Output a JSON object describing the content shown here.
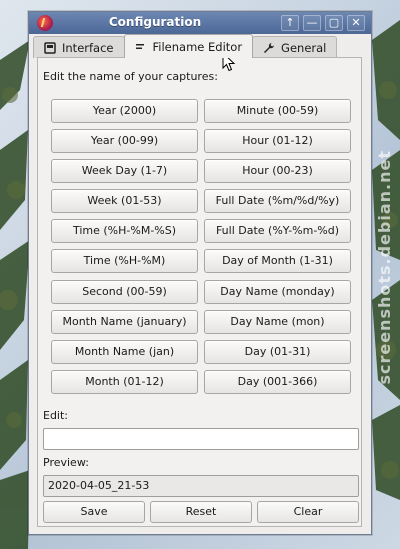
{
  "window": {
    "title": "Configuration",
    "controls": [
      "↑",
      "—",
      "▢",
      "✕"
    ]
  },
  "tabs": [
    {
      "label": "Interface",
      "icon": "interface-icon",
      "active": false
    },
    {
      "label": "Filename Editor",
      "icon": "text-lines-icon",
      "active": true
    },
    {
      "label": "General",
      "icon": "wrench-icon",
      "active": false
    }
  ],
  "editor": {
    "prompt": "Edit the name of your captures:",
    "buttons_left": [
      "Year (2000)",
      "Year (00-99)",
      "Week Day (1-7)",
      "Week (01-53)",
      "Time (%H-%M-%S)",
      "Time (%H-%M)",
      "Second (00-59)",
      "Month Name (january)",
      "Month Name (jan)",
      "Month (01-12)"
    ],
    "buttons_right": [
      "Minute (00-59)",
      "Hour (01-12)",
      "Hour (00-23)",
      "Full Date (%m/%d/%y)",
      "Full Date (%Y-%m-%d)",
      "Day of Month (1-31)",
      "Day Name (monday)",
      "Day Name (mon)",
      "Day (01-31)",
      "Day (001-366)"
    ],
    "edit_label": "Edit:",
    "edit_value": "",
    "preview_label": "Preview:",
    "preview_value": "2020-04-05_21-53",
    "save_label": "Save",
    "reset_label": "Reset",
    "clear_label": "Clear"
  },
  "background": {
    "watermark": "screenshots.debian.net"
  }
}
